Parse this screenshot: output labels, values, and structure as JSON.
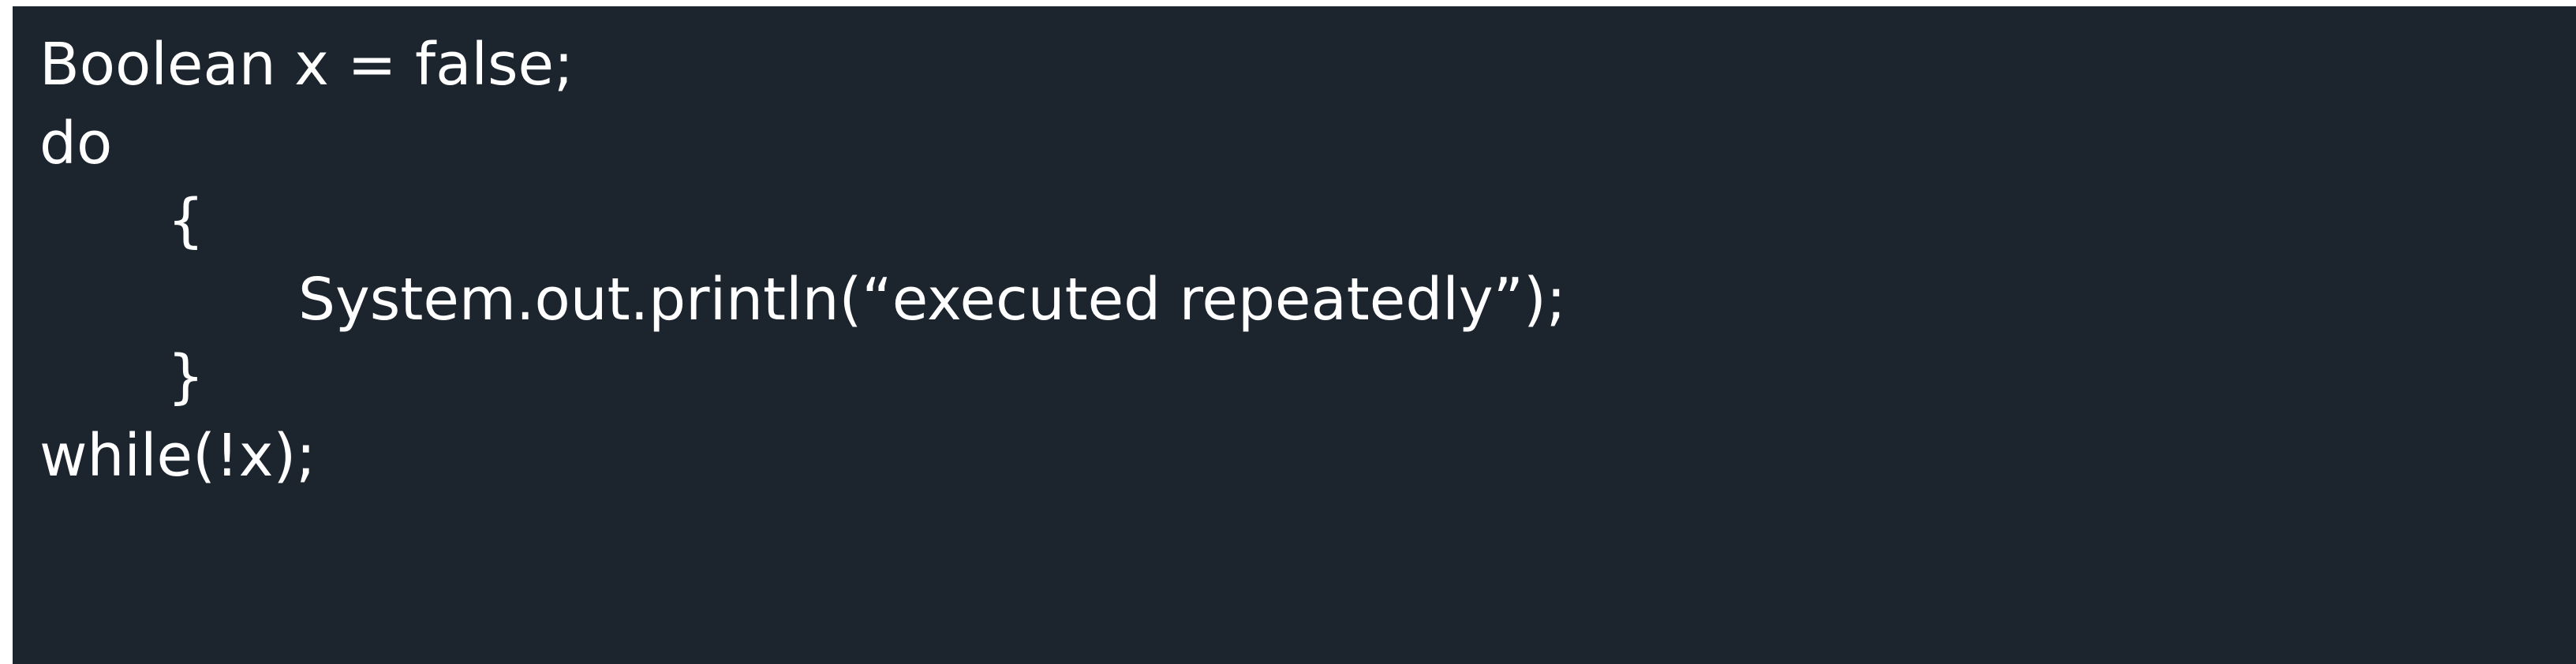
{
  "colors": {
    "panel_background": "#1c252e",
    "text": "#ffffff",
    "page_background": "#ffffff"
  },
  "code": {
    "lines": [
      "Boolean x = false;",
      "do",
      "{",
      "System.out.println(“executed repeatedly”);",
      "}",
      "while(!x);"
    ]
  }
}
